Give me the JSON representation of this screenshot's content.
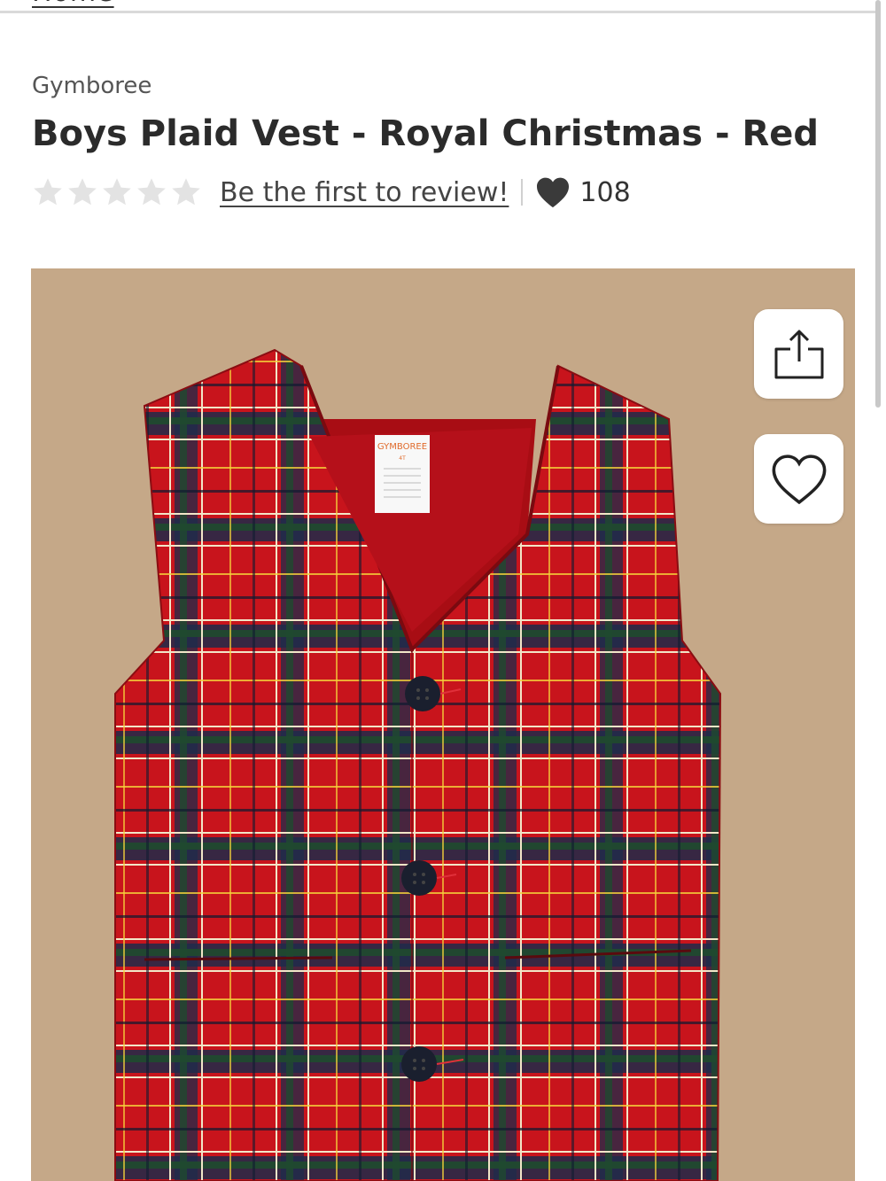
{
  "breadcrumb": {
    "label": "Home"
  },
  "product": {
    "brand": "Gymboree",
    "title": "Boys Plaid Vest - Royal Christmas - Red",
    "rating": {
      "stars": 0,
      "max_stars": 5,
      "review_link": "Be the first to review!"
    },
    "favorites_count": "108",
    "image": {
      "tag_brand": "GYMBOREE",
      "tag_size": "4T"
    }
  },
  "icons": {
    "star": "star-icon",
    "favorite": "heart-filled-icon",
    "share": "share-icon",
    "wishlist": "heart-outline-icon"
  },
  "colors": {
    "star_empty": "#e3e3e3",
    "heart": "#3a3a3a",
    "background_image": "#c5a888",
    "plaid_red": "#c8141c"
  }
}
